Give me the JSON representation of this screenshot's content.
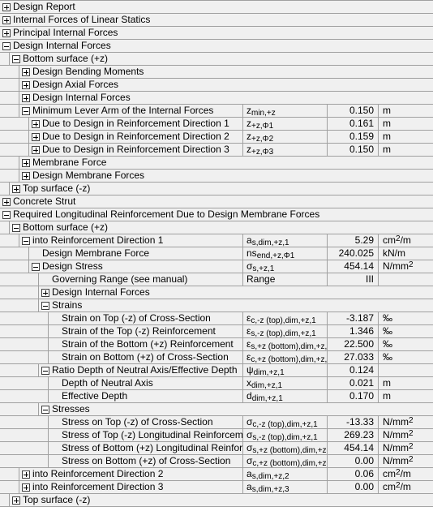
{
  "rows": [
    {
      "level": 0,
      "state": "collapsed",
      "label": "Design Report"
    },
    {
      "level": 0,
      "state": "collapsed",
      "label": "Internal Forces of Linear Statics"
    },
    {
      "level": 0,
      "state": "collapsed",
      "label": "Principal Internal Forces"
    },
    {
      "level": 0,
      "state": "expanded",
      "label": "Design Internal Forces"
    },
    {
      "level": 1,
      "state": "expanded",
      "label": "Bottom surface (+z)"
    },
    {
      "level": 2,
      "state": "collapsed",
      "label": "Design Bending Moments"
    },
    {
      "level": 2,
      "state": "collapsed",
      "label": "Design Axial Forces"
    },
    {
      "level": 2,
      "state": "collapsed",
      "label": "Design Internal Forces"
    },
    {
      "level": 2,
      "state": "expanded",
      "label": "Minimum Lever Arm of the Internal Forces",
      "symbol": "z",
      "symbol_sub": "min,+z",
      "value": "0.150",
      "unit": "m"
    },
    {
      "level": 3,
      "state": "collapsed",
      "label": "Due to Design in Reinforcement Direction 1",
      "symbol": "z",
      "symbol_sub": "+z,Φ1",
      "value": "0.161",
      "unit": "m"
    },
    {
      "level": 3,
      "state": "collapsed",
      "label": "Due to Design in Reinforcement Direction 2",
      "symbol": "z",
      "symbol_sub": "+z,Φ2",
      "value": "0.159",
      "unit": "m"
    },
    {
      "level": 3,
      "state": "collapsed",
      "label": "Due to Design in Reinforcement Direction 3",
      "symbol": "z",
      "symbol_sub": "+z,Φ3",
      "value": "0.150",
      "unit": "m"
    },
    {
      "level": 2,
      "state": "collapsed",
      "label": "Membrane Force"
    },
    {
      "level": 2,
      "state": "collapsed",
      "label": "Design Membrane Forces"
    },
    {
      "level": 1,
      "state": "collapsed",
      "label": "Top surface (-z)"
    },
    {
      "level": 0,
      "state": "collapsed",
      "label": "Concrete Strut"
    },
    {
      "level": 0,
      "state": "expanded",
      "label": "Required Longitudinal Reinforcement Due to Design Membrane Forces"
    },
    {
      "level": 1,
      "state": "expanded",
      "label": "Bottom surface (+z)"
    },
    {
      "level": 2,
      "state": "expanded",
      "label": "into Reinforcement Direction 1",
      "symbol": "a",
      "symbol_sub": "s,dim,+z,1",
      "value": "5.29",
      "unit": "cm",
      "unit_sup": "2",
      "unit_tail": "/m"
    },
    {
      "level": 3,
      "state": "leaf",
      "label": "Design Membrane Force",
      "symbol": "ns",
      "symbol_sub": "end,+z,Φ1",
      "value": "240.025",
      "unit": "kN/m"
    },
    {
      "level": 3,
      "state": "expanded",
      "label": "Design Stress",
      "symbol": "σ",
      "symbol_sub": "s,+z,1",
      "value": "454.14",
      "unit": "N/mm",
      "unit_sup": "2"
    },
    {
      "level": 4,
      "state": "leaf",
      "label": "Governing Range (see manual)",
      "symbol": "Range",
      "value": "III",
      "unit": ""
    },
    {
      "level": 4,
      "state": "collapsed",
      "label": "Design Internal Forces"
    },
    {
      "level": 4,
      "state": "expanded",
      "label": "Strains"
    },
    {
      "level": 5,
      "state": "leaf",
      "label": "Strain on Top (-z) of Cross-Section",
      "symbol": "ε",
      "symbol_sub": "c,-z (top),dim,+z,1",
      "value": "-3.187",
      "unit": "‰"
    },
    {
      "level": 5,
      "state": "leaf",
      "label": "Strain of the Top (-z) Reinforcement",
      "symbol": "ε",
      "symbol_sub": "s,-z (top),dim,+z,1",
      "value": "1.346",
      "unit": "‰"
    },
    {
      "level": 5,
      "state": "leaf",
      "label": "Strain of the Bottom (+z) Reinforcement",
      "symbol": "ε",
      "symbol_sub": "s,+z (bottom),dim,+z,1",
      "value": "22.500",
      "unit": "‰"
    },
    {
      "level": 5,
      "state": "leaf",
      "label": "Strain on Bottom (+z) of Cross-Section",
      "symbol": "ε",
      "symbol_sub": "c,+z (bottom),dim,+z,1",
      "value": "27.033",
      "unit": "‰"
    },
    {
      "level": 4,
      "state": "expanded",
      "label": "Ratio Depth of Neutral Axis/Effective Depth",
      "symbol": "ψ",
      "symbol_sub": "dim,+z,1",
      "value": "0.124",
      "unit": ""
    },
    {
      "level": 5,
      "state": "leaf",
      "label": "Depth of Neutral Axis",
      "symbol": "x",
      "symbol_sub": "dim,+z,1",
      "value": "0.021",
      "unit": "m"
    },
    {
      "level": 5,
      "state": "leaf",
      "label": "Effective Depth",
      "symbol": "d",
      "symbol_sub": "dim,+z,1",
      "value": "0.170",
      "unit": "m"
    },
    {
      "level": 4,
      "state": "expanded",
      "label": "Stresses"
    },
    {
      "level": 5,
      "state": "leaf",
      "label": "Stress on Top (-z) of Cross-Section",
      "symbol": "σ",
      "symbol_sub": "c,-z (top),dim,+z,1",
      "value": "-13.33",
      "unit": "N/mm",
      "unit_sup": "2"
    },
    {
      "level": 5,
      "state": "leaf",
      "label": "Stress of Top (-z) Longitudinal Reinforcement",
      "symbol": "σ",
      "symbol_sub": "s,-z (top),dim,+z,1",
      "value": "269.23",
      "unit": "N/mm",
      "unit_sup": "2"
    },
    {
      "level": 5,
      "state": "leaf",
      "label": "Stress of Bottom (+z) Longitudinal Reinforcement",
      "symbol": "σ",
      "symbol_sub": "s,+z (bottom),dim,+z,1",
      "value": "454.14",
      "unit": "N/mm",
      "unit_sup": "2"
    },
    {
      "level": 5,
      "state": "leaf",
      "label": "Stress on Bottom (+z) of Cross-Section",
      "symbol": "σ",
      "symbol_sub": "c,+z (bottom),dim,+z,1",
      "value": "0.00",
      "unit": "N/mm",
      "unit_sup": "2"
    },
    {
      "level": 2,
      "state": "collapsed",
      "label": "into Reinforcement Direction 2",
      "symbol": "a",
      "symbol_sub": "s,dim,+z,2",
      "value": "0.06",
      "unit": "cm",
      "unit_sup": "2",
      "unit_tail": "/m"
    },
    {
      "level": 2,
      "state": "collapsed",
      "label": "into Reinforcement Direction 3",
      "symbol": "a",
      "symbol_sub": "s,dim,+z,3",
      "value": "0.00",
      "unit": "cm",
      "unit_sup": "2",
      "unit_tail": "/m"
    },
    {
      "level": 1,
      "state": "collapsed",
      "label": "Top surface (-z)"
    }
  ]
}
